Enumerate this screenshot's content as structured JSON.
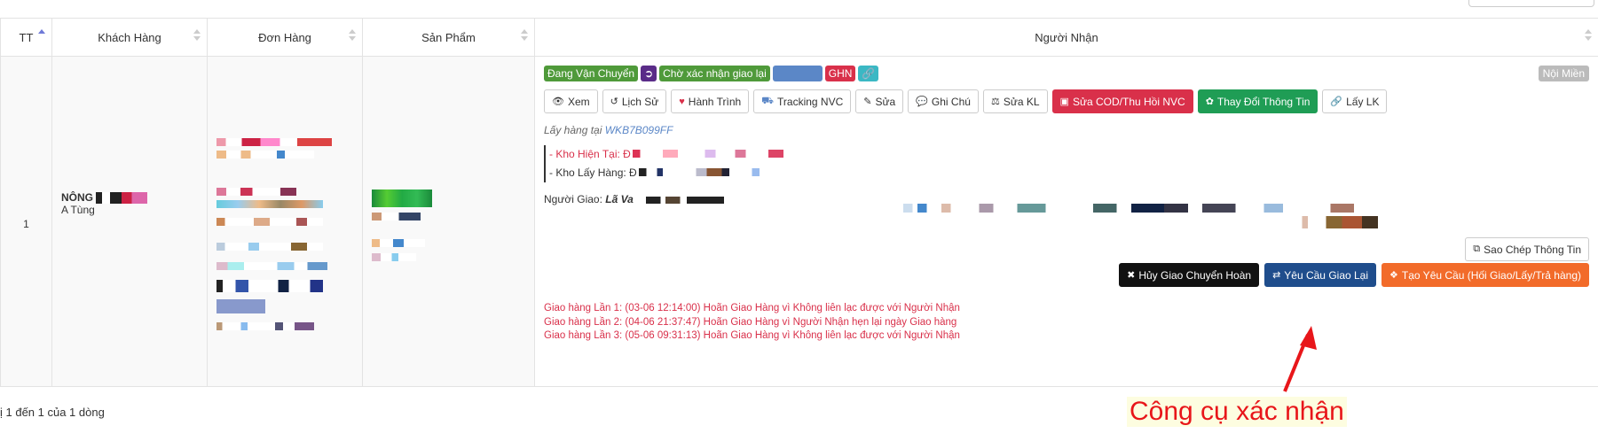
{
  "table": {
    "headers": {
      "tt": "TT",
      "customer": "Khách Hàng",
      "order": "Đơn Hàng",
      "product": "Sản Phẩm",
      "receiver": "Người Nhận"
    },
    "row": {
      "index": "1",
      "customer_name": "NÔNG",
      "customer_sub": "A Tùng"
    }
  },
  "receiver": {
    "badges": [
      {
        "label": "Đang Vận Chuyển",
        "color": "#4f9a3a"
      },
      {
        "label": "",
        "color": "#5a2c88",
        "icon": "exit-icon"
      },
      {
        "label": "Chờ xác nhận giao lại",
        "color": "#4f9a3a"
      },
      {
        "label": "",
        "color": "#5b87c7"
      },
      {
        "label": "GHN",
        "color": "#d9304a"
      },
      {
        "label": "",
        "color": "#3bb8c4",
        "icon": "link-icon"
      }
    ],
    "region": "Nội Miền",
    "buttons": {
      "view": "Xem",
      "history": "Lịch Sử",
      "journey": "Hành Trình",
      "tracking": "Tracking NVC",
      "edit": "Sửa",
      "note": "Ghi Chú",
      "edit_weight": "Sửa KL",
      "edit_cod": "Sửa COD/Thu Hồi NVC",
      "change_info": "Thay Đổi Thông Tin",
      "get_link": "Lấy LK"
    },
    "pickup_prefix": "Lấy hàng tại",
    "pickup_code": "WKB7B099FF",
    "current_warehouse": "- Kho Hiện Tại: Đ",
    "pickup_warehouse": "- Kho Lấy Hàng: Đ",
    "deliverer_label": "Người Giao:",
    "deliverer_name": "Lã Va",
    "copy_button": "Sao Chép Thông Tin",
    "actions": {
      "cancel_return": "Hủy Giao Chuyển Hoàn",
      "request_redeliver": "Yêu Cầu Giao Lại",
      "create_request": "Tạo Yêu Cầu (Hối Giao/Lấy/Trả hàng)"
    },
    "log": [
      "Giao hàng Lần 1: (03-06 12:14:00) Hoãn Giao Hàng vì Không liên lạc được với Người Nhận",
      "Giao hàng Lần 2: (04-06 21:37:47) Hoãn Giao Hàng vì Người Nhận hẹn lại ngày Giao hàng",
      "Giao hàng Lần 3: (05-06 09:31:13) Hoãn Giao Hàng vì Không liên lạc được với Người Nhận"
    ]
  },
  "footer": "ị 1 đến 1 của 1 dòng",
  "annotation": "Công cụ xác nhận"
}
